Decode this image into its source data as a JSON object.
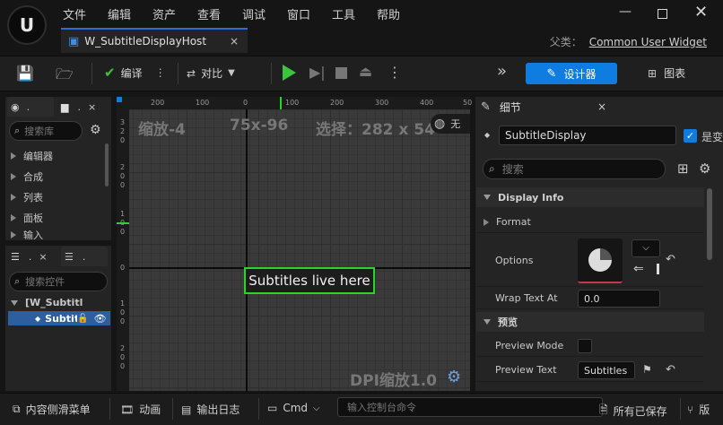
{
  "menu": [
    "文件",
    "编辑",
    "资产",
    "查看",
    "调试",
    "窗口",
    "工具",
    "帮助"
  ],
  "document_tab": {
    "title": "W_SubtitleDisplayHost",
    "close": "×"
  },
  "parent": {
    "label": "父类：",
    "value": "Common User Widget"
  },
  "toolbar": {
    "compile": "编译",
    "diff": "对比",
    "designer": "设计器",
    "graph": "图表"
  },
  "palette": {
    "tab_label": ".",
    "tab2_label": ".",
    "search_placeholder": "搜索库",
    "categories": [
      "编辑器",
      "合成",
      "列表",
      "面板",
      "输入"
    ]
  },
  "hierarchy": {
    "tab_label": ".",
    "tab2_label": ".",
    "search_placeholder": "搜索控件",
    "root": "[W_Subtitl",
    "child": "Subtit"
  },
  "canvas": {
    "zoom_label": "缩放-4",
    "size_label": "75x-96",
    "selection_label": "选择：282 x 54",
    "dpi_label": "DPI缩放1.0",
    "mode_label": "无",
    "widget_text": "Subtitles live here",
    "ruler_top": [
      "200",
      "100",
      "0",
      "100",
      "200",
      "300",
      "400",
      "50"
    ],
    "ruler_left": [
      "3\n2\n0",
      "2\n0\n0",
      "1\n0\n0",
      "0",
      "1\n0\n0",
      "2\n0\n0"
    ]
  },
  "details": {
    "tab_label": "细节",
    "widget_name": "SubtitleDisplay",
    "is_variable_label": "是变",
    "search_placeholder": "搜索",
    "sections": [
      "Display Info",
      "预览"
    ],
    "props": {
      "format": "Format",
      "options": "Options",
      "wrap_label": "Wrap Text At",
      "wrap_value": "0.0",
      "preview_mode": "Preview Mode",
      "preview_text": "Preview Text",
      "preview_text_value": "Subtitles"
    }
  },
  "statusbar": {
    "content_drawer": "内容侧滑菜单",
    "animation": "动画",
    "output_log": "输出日志",
    "cmd": "Cmd",
    "console_placeholder": "输入控制台命令",
    "saved": "所有已保存",
    "version": "版"
  },
  "colors": {
    "accent": "#0e7ce0",
    "selection_green": "#2fd02f",
    "play_green": "#3cc43c"
  }
}
